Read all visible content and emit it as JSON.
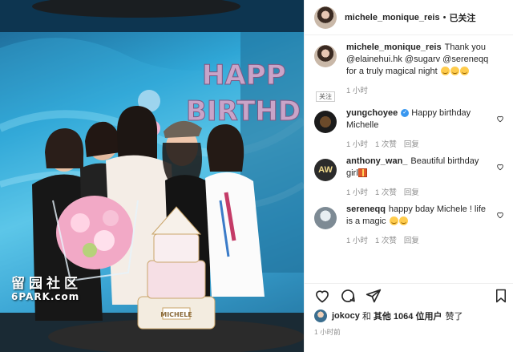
{
  "post": {
    "username": "michele_monique_reis",
    "dot": "•",
    "follow_label": "已关注"
  },
  "caption": {
    "username": "michele_monique_reis",
    "text": "Thank you @elainehui.hk @sugarv @sereneqq for a truly magical night",
    "time": "1 小时",
    "tag": "关注"
  },
  "comments": [
    {
      "username": "yungchoyee",
      "verified": true,
      "text": "Happy birthday Michelle",
      "time": "1 小时",
      "likes": "1 次赞",
      "reply": "回复"
    },
    {
      "username": "anthony_wan_",
      "text": "Beautiful birthday girl",
      "time": "1 小时",
      "likes": "1 次赞",
      "reply": "回复"
    },
    {
      "username": "sereneqq",
      "text": "happy bday Michele ! life is a magic",
      "time": "1 小时",
      "likes": "1 次赞",
      "reply": "回复"
    }
  ],
  "likes_line": {
    "user": "jokocy",
    "and": "和",
    "others": "其他 1064 位用户",
    "suffix": "赞了"
  },
  "timestamp": "1 小时前",
  "photo": {
    "balloon_text": "HAPPY BIRTHDAY",
    "cake_label": "MICHELE",
    "watermark_line1": "留园社区",
    "watermark_line2": "6PARK.com"
  },
  "icons": [
    "heart-icon",
    "comment-icon",
    "share-icon",
    "bookmark-icon",
    "verified-icon"
  ],
  "colors": {
    "link": "#00376b",
    "meta": "#8e8e8e",
    "verified": "#3897f0",
    "text": "#262626"
  }
}
